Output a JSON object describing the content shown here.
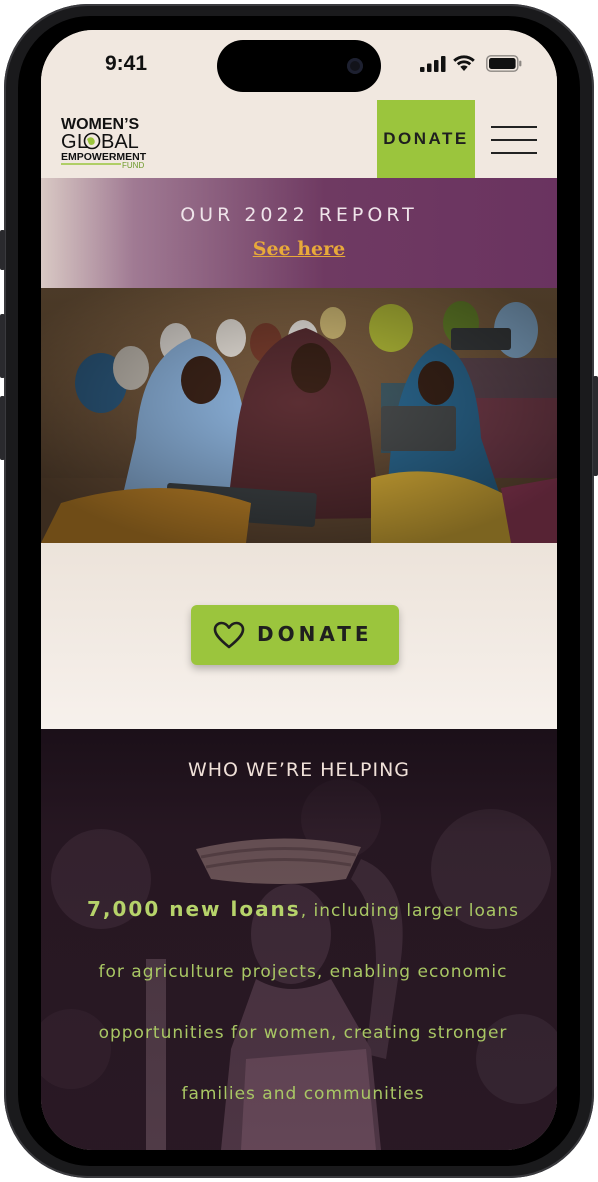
{
  "status_bar": {
    "time": "9:41"
  },
  "header": {
    "logo_lines": [
      "WOMEN'S",
      "GLOBAL",
      "EMPOWERMENT",
      "FUND"
    ],
    "donate_label": "DONATE"
  },
  "report": {
    "title": "OUR 2022 REPORT",
    "link": "See here"
  },
  "donate_section": {
    "button_label": "DONATE"
  },
  "helping": {
    "title": "WHO WE’RE HELPING",
    "highlight": "7,000 new loans",
    "body": ", including larger loans for agriculture projects, enabling economic opportunities for women, creating stronger families and communities"
  },
  "colors": {
    "accent_green": "#9bc53d",
    "banner_purple": "#6f3a62",
    "link_orange": "#e8a93a",
    "dark_section": "#2a1a24"
  },
  "icons": [
    "signal-icon",
    "wifi-icon",
    "battery-icon",
    "hamburger-menu-icon",
    "heart-icon"
  ]
}
